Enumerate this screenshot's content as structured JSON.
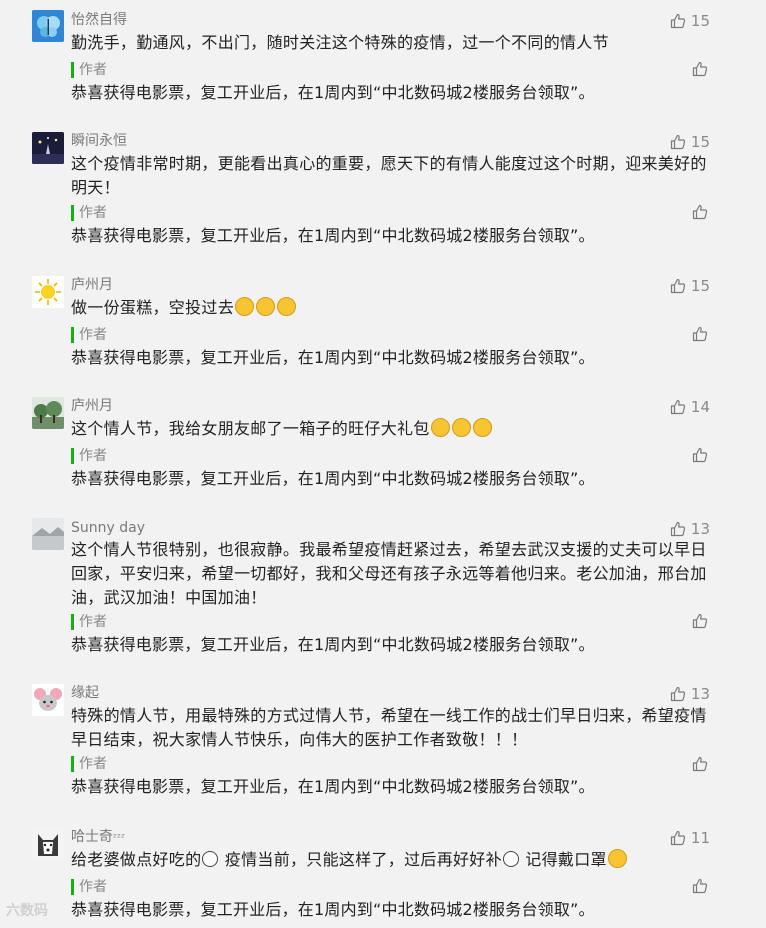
{
  "author_label": "作者",
  "reply_text": "恭喜获得电影票，复工开业后，在1周内到“中北数码城2楼服务台领取”。",
  "comments": [
    {
      "name": "怡然自得",
      "likes": "15",
      "text": "勤洗手，勤通风，不出门，随时关注这个特殊的疫情，过一个不同的情人节",
      "avatar": "butterfly"
    },
    {
      "name": "瞬间永恒",
      "likes": "15",
      "text": "这个疫情非常时期，更能看出真心的重要，愿天下的有情人能度过这个时期，迎来美好的明天！",
      "avatar": "night-lights"
    },
    {
      "name": "庐州月",
      "likes": "15",
      "text": "做一份蛋糕，空投过去",
      "emojis": [
        "cake",
        "cake",
        "cake"
      ],
      "avatar": "sun"
    },
    {
      "name": "庐州月",
      "likes": "14",
      "text": "这个情人节，我给女朋友邮了一箱子的旺仔大礼包",
      "emojis": [
        "grin",
        "grin",
        "grin"
      ],
      "avatar": "trees"
    },
    {
      "name": "Sunny day",
      "likes": "13",
      "text": "这个情人节很特别，也很寂静。我最希望疫情赶紧过去，希望去武汉支援的丈夫可以早日回家，平安归来，希望一切都好，我和父母还有孩子永远等着他归来。老公加油，邢台加油，武汉加油！中国加油！",
      "avatar": "snow"
    },
    {
      "name": "缘起",
      "likes": "13",
      "text": "特殊的情人节，用最特殊的方式过情人节，希望在一线工作的战士们早日归来，希望疫情早日结束，祝大家情人节快乐，向伟大的医护工作者致敬！！！",
      "avatar": "mouse"
    },
    {
      "name": "哈士奇",
      "name_suffix": "ᶻᶻᶻ",
      "likes": "11",
      "text_parts": [
        "给老婆做点好吃的",
        " 疫情当前，只能这样了，过后再好好补",
        " 记得戴口罩"
      ],
      "avatar": "husky"
    }
  ],
  "watermark": "六数码"
}
